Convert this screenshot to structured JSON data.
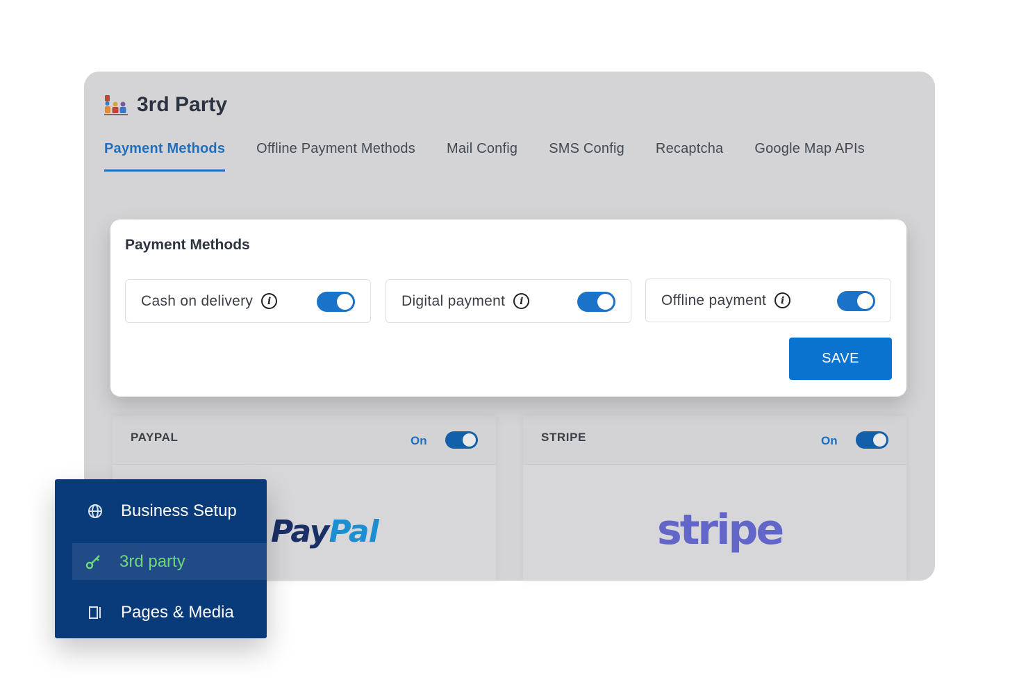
{
  "header": {
    "title": "3rd Party",
    "icon": "third-party-icon"
  },
  "tabs": [
    {
      "label": "Payment Methods",
      "active": true
    },
    {
      "label": "Offline Payment Methods",
      "active": false
    },
    {
      "label": "Mail Config",
      "active": false
    },
    {
      "label": "SMS Config",
      "active": false
    },
    {
      "label": "Recaptcha",
      "active": false
    },
    {
      "label": "Google Map APIs",
      "active": false
    }
  ],
  "payment_card": {
    "title": "Payment Methods",
    "methods": [
      {
        "label": "Cash on delivery",
        "enabled": true
      },
      {
        "label": "Digital payment",
        "enabled": true
      },
      {
        "label": "Offline payment",
        "enabled": true
      }
    ],
    "save_label": "SAVE"
  },
  "gateways": [
    {
      "name": "PAYPAL",
      "status_label": "On",
      "enabled": true,
      "logo_text_a": "Pay",
      "logo_text_b": "Pal"
    },
    {
      "name": "STRIPE",
      "status_label": "On",
      "enabled": true,
      "logo_text": "stripe"
    }
  ],
  "sidebar": {
    "items": [
      {
        "label": "Business Setup",
        "icon": "globe-icon",
        "active": false
      },
      {
        "label": "3rd party",
        "icon": "key-icon",
        "active": true
      },
      {
        "label": "Pages & Media",
        "icon": "page-icon",
        "active": false
      }
    ]
  },
  "colors": {
    "accent": "#1f6fbe",
    "toggle_on": "#1a73c8",
    "save_button": "#0a73cf",
    "sidebar_bg": "#093b7a",
    "sidebar_active_text": "#6fd77a",
    "stripe_brand": "#6266c9",
    "paypal_dark": "#1a2f66",
    "paypal_light": "#1b8fd2"
  }
}
